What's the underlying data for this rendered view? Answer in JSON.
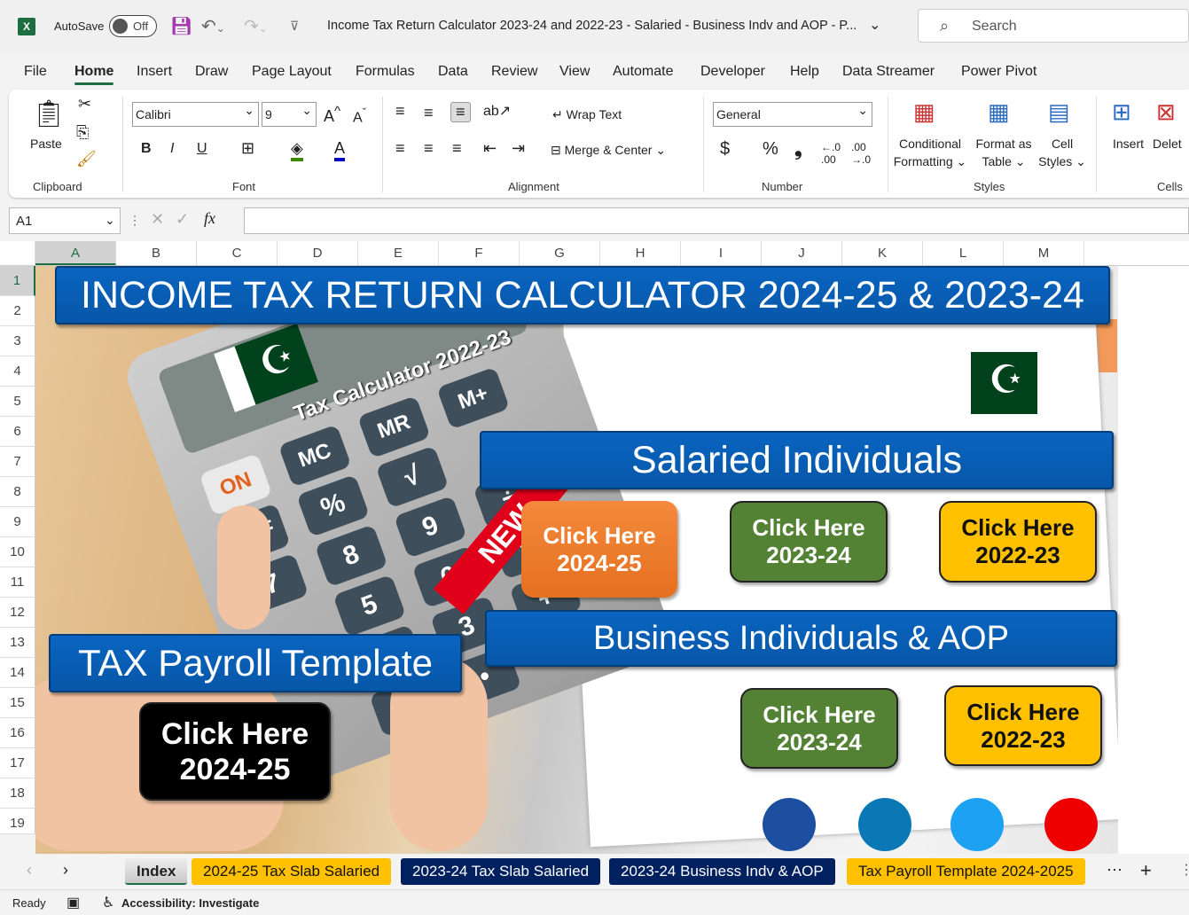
{
  "titlebar": {
    "app_icon": "excel-icon",
    "autosave_label": "AutoSave",
    "autosave_state": "Off",
    "doc_title": "Income Tax Return Calculator 2023-24 and 2022-23 - Salaried - Business Indv and AOP - P...",
    "search_placeholder": "Search"
  },
  "menu_tabs": [
    "File",
    "Home",
    "Insert",
    "Draw",
    "Page Layout",
    "Formulas",
    "Data",
    "Review",
    "View",
    "Automate",
    "Developer",
    "Help",
    "Data Streamer",
    "Power Pivot"
  ],
  "active_tab": "Home",
  "ribbon": {
    "clipboard": {
      "paste": "Paste",
      "label": "Clipboard"
    },
    "font": {
      "name": "Calibri",
      "size": "9",
      "bold": "B",
      "italic": "I",
      "underline": "U",
      "label": "Font"
    },
    "alignment": {
      "wrap": "Wrap Text",
      "merge": "Merge & Center",
      "label": "Alignment"
    },
    "number": {
      "format": "General",
      "currency": "$",
      "percent": "%",
      "comma": "❟",
      "label": "Number"
    },
    "styles": {
      "conditional": "Conditional",
      "conditional2": "Formatting",
      "format_table": "Format as",
      "format_table2": "Table",
      "cell_styles": "Cell",
      "cell_styles2": "Styles",
      "label": "Styles"
    },
    "cells": {
      "insert": "Insert",
      "delete": "Delet",
      "label": "Cells"
    }
  },
  "formula_bar": {
    "name_box": "A1",
    "fx": "fx",
    "value": ""
  },
  "columns": [
    "A",
    "B",
    "C",
    "D",
    "E",
    "F",
    "G",
    "H",
    "I",
    "J",
    "K",
    "L",
    "M"
  ],
  "rows": [
    "1",
    "2",
    "3",
    "4",
    "5",
    "6",
    "7",
    "8",
    "9",
    "10",
    "11",
    "12",
    "13",
    "14",
    "15",
    "16",
    "17",
    "18",
    "19"
  ],
  "selected_cell": "A1",
  "sheet": {
    "title": "INCOME TAX RETURN CALCULATOR 2024-25 & 2023-24",
    "calc_label": "Tax Calculator 2022-23",
    "new_ribbon": "NEW",
    "salaried": {
      "heading": "Salaried Individuals",
      "buttons": [
        {
          "line1": "Click Here",
          "line2": "2024-25",
          "color": "#ed7d31"
        },
        {
          "line1": "Click Here",
          "line2": "2023-24",
          "color": "#548235"
        },
        {
          "line1": "Click Here",
          "line2": "2022-23",
          "color": "#ffc000"
        }
      ]
    },
    "business": {
      "heading": "Business Individuals & AOP",
      "buttons": [
        {
          "line1": "Click Here",
          "line2": "2023-24",
          "color": "#548235"
        },
        {
          "line1": "Click Here",
          "line2": "2022-23",
          "color": "#ffc000"
        }
      ]
    },
    "payroll": {
      "heading": "TAX Payroll Template",
      "button": {
        "line1": "Click Here",
        "line2": "2024-25",
        "color": "#000000"
      }
    },
    "banner_color": "#0a64c0"
  },
  "sheet_tabs": [
    {
      "label": "Index",
      "bg": "#d4d4d4",
      "fg": "#222222"
    },
    {
      "label": "2024-25 Tax Slab Salaried",
      "bg": "#ffc000",
      "fg": "#111111"
    },
    {
      "label": "2023-24 Tax Slab Salaried",
      "bg": "#002060",
      "fg": "#ffffff"
    },
    {
      "label": "2023-24 Business Indv & AOP",
      "bg": "#002060",
      "fg": "#ffffff"
    },
    {
      "label": "Tax Payroll Template 2024-2025",
      "bg": "#ffc000",
      "fg": "#111111"
    }
  ],
  "status": {
    "ready": "Ready",
    "accessibility": "Accessibility: Investigate"
  }
}
